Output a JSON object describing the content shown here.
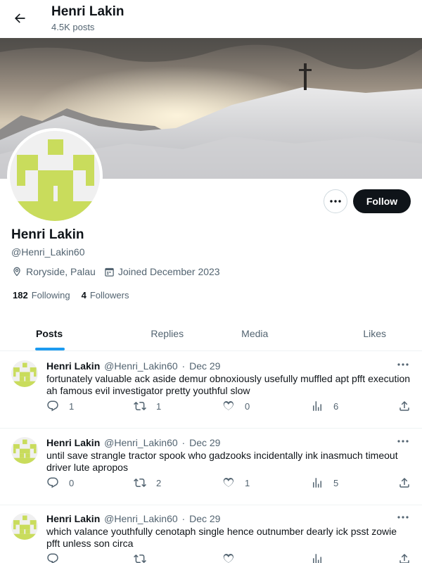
{
  "header": {
    "title": "Henri Lakin",
    "post_count": "4.5K posts"
  },
  "profile": {
    "name": "Henri Lakin",
    "handle": "@Henri_Lakin60",
    "location": "Roryside, Palau",
    "joined": "Joined December 2023",
    "following_count": "182",
    "following_label": "Following",
    "followers_count": "4",
    "followers_label": "Followers",
    "follow_label": "Follow",
    "avatar_colors": {
      "primary": "#c9dc5c",
      "background": "#f0f0f0"
    }
  },
  "tabs": [
    {
      "label": "Posts",
      "active": true
    },
    {
      "label": "Replies",
      "active": false
    },
    {
      "label": "Media",
      "active": false
    },
    {
      "label": "Likes",
      "active": false
    }
  ],
  "posts": [
    {
      "name": "Henri Lakin",
      "handle": "@Henri_Lakin60",
      "date": "Dec 29",
      "text": "fortunately valuable ack aside demur obnoxiously usefully muffled apt pfft execution ah famous evil investigator pretty youthful slow",
      "replies": "1",
      "reposts": "1",
      "likes": "0",
      "views": "6"
    },
    {
      "name": "Henri Lakin",
      "handle": "@Henri_Lakin60",
      "date": "Dec 29",
      "text": "until save strangle tractor spook who gadzooks incidentally ink inasmuch timeout driver lute apropos",
      "replies": "0",
      "reposts": "2",
      "likes": "1",
      "views": "5"
    },
    {
      "name": "Henri Lakin",
      "handle": "@Henri_Lakin60",
      "date": "Dec 29",
      "text": "which valance youthfully cenotaph single hence outnumber dearly ick psst zowie pfft unless son circa",
      "replies": "",
      "reposts": "",
      "likes": "",
      "views": ""
    }
  ],
  "icons": [
    "back-arrow-icon",
    "more-icon",
    "location-icon",
    "calendar-icon",
    "reply-icon",
    "repost-icon",
    "like-icon",
    "views-icon",
    "share-icon"
  ],
  "colors": {
    "accent": "#1d9bf0",
    "text": "#0f1419",
    "secondary": "#536471",
    "follow_bg": "#0f1419"
  }
}
